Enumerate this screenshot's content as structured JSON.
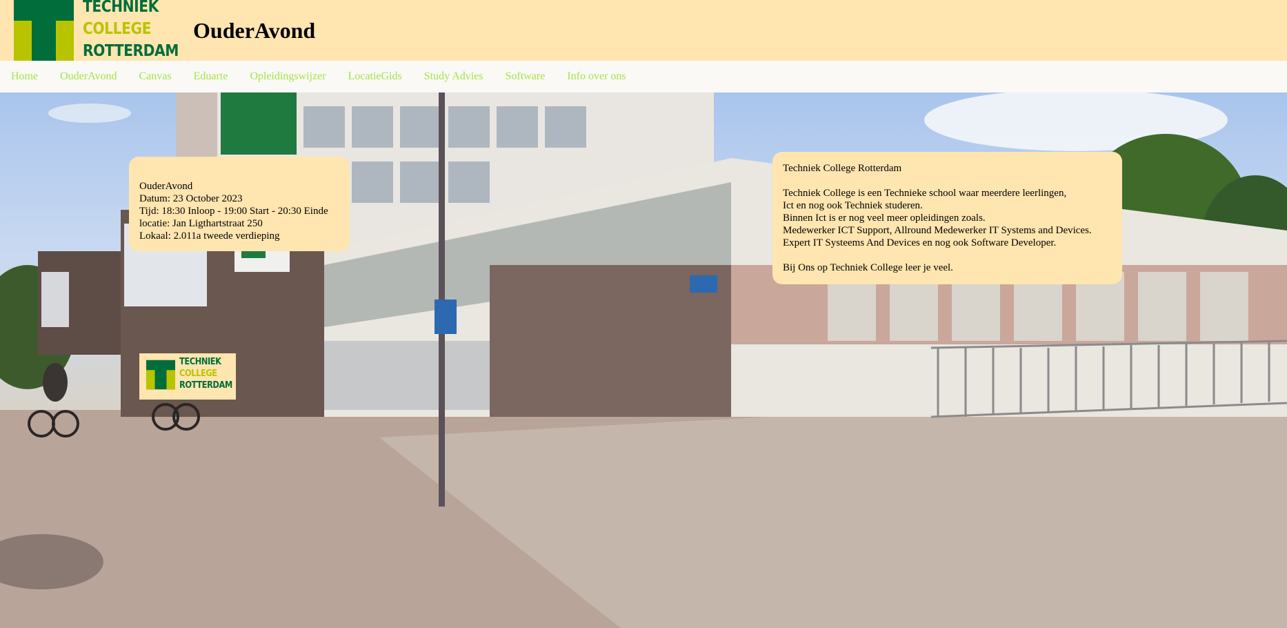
{
  "header": {
    "logo": {
      "line1": "TECHNIEK",
      "line2": "COLLEGE",
      "line3": "ROTTERDAM",
      "colors": {
        "dark_green": "#006d3a",
        "lime": "#b8c400"
      }
    },
    "title": "OuderAvond"
  },
  "nav": {
    "items": [
      {
        "label": "Home"
      },
      {
        "label": "OuderAvond"
      },
      {
        "label": "Canvas"
      },
      {
        "label": "Eduarte"
      },
      {
        "label": "Opleidingswijzer"
      },
      {
        "label": "LocatieGids"
      },
      {
        "label": "Study Advies"
      },
      {
        "label": "Software"
      },
      {
        "label": "Info over ons"
      }
    ],
    "link_color": "#a6e34a"
  },
  "event_card": {
    "title": "OuderAvond",
    "date": "Datum: 23 October 2023",
    "time": "Tijd: 18:30 Inloop - 19:00 Start - 20:30 Einde",
    "location": "locatie: Jan Ligthartstraat 250",
    "room": "Lokaal: 2.011a tweede verdieping"
  },
  "info_card": {
    "title": "Techniek College Rotterdam",
    "lines": [
      "Techniek College is een Technieke school waar meerdere leerlingen,",
      "Ict en nog ook Techniek studeren.",
      "Binnen Ict is er nog veel meer opleidingen zoals.",
      "Medewerker ICT Support, Allround Medewerker IT Systems and Devices.",
      "Expert IT Systeems And Devices en nog ook Software Developer."
    ],
    "closing": "Bij Ons op Techniek College leer je veel."
  },
  "colors": {
    "header_bg": "#ffe5b0",
    "nav_bg": "#faf9f5",
    "card_bg": "#ffe5b0"
  }
}
